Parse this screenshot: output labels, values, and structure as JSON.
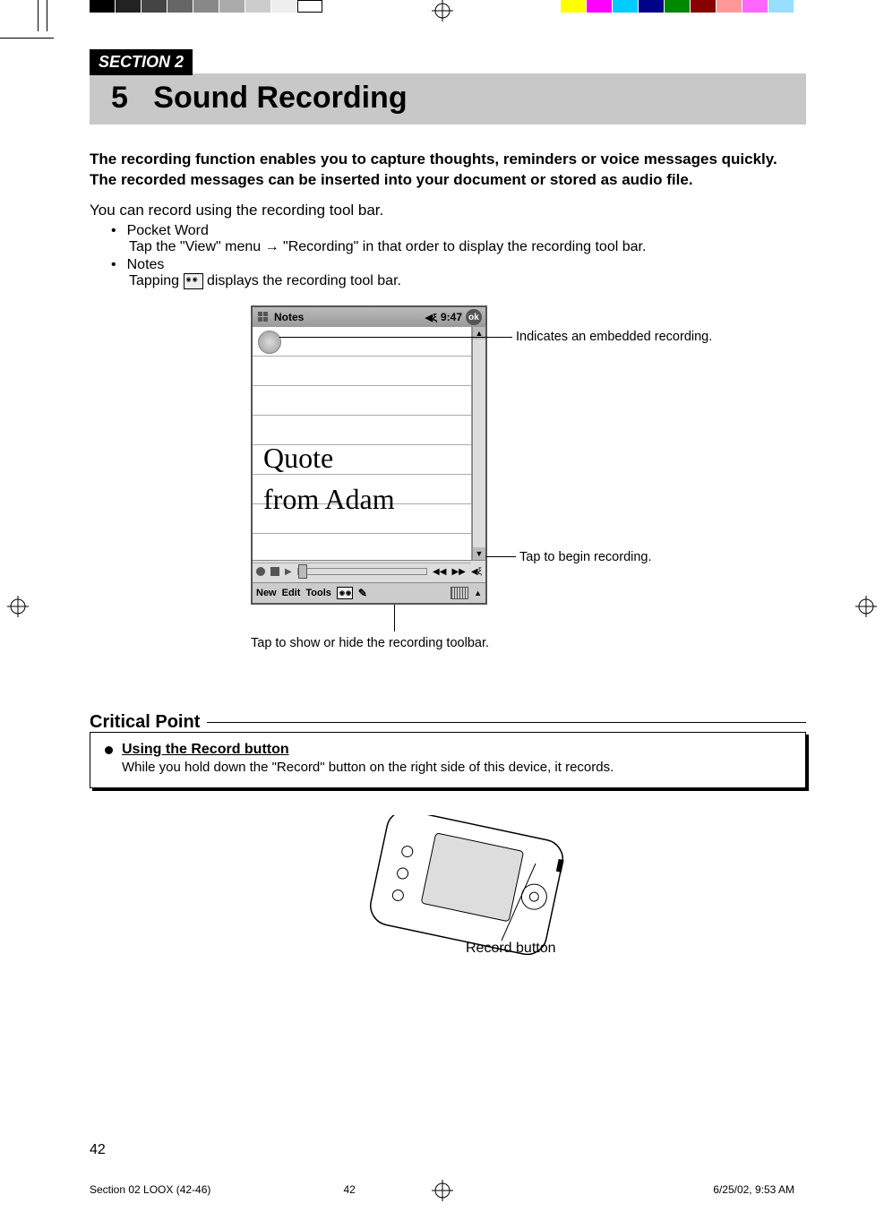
{
  "section_tab": "SECTION 2",
  "chapter_number": "5",
  "chapter_title": "Sound Recording",
  "intro": "The recording function enables you to capture thoughts, reminders or voice messages quickly. The recorded messages can be inserted into your document or stored as audio file.",
  "body_lead": "You can record using the recording tool bar.",
  "bullets": {
    "b1_head": "Pocket Word",
    "b1_sub": "Tap the \"View\" menu → \"Recording\" in that order to display the recording tool bar.",
    "b2_head": "Notes",
    "b2_sub_before": "Tapping ",
    "b2_sub_after": " displays the recording tool bar."
  },
  "screenshot": {
    "app_title": "Notes",
    "time": "9:47",
    "ok": "ok",
    "handwriting_line1": "Quote",
    "handwriting_line2": "from Adam",
    "menu_new": "New",
    "menu_edit": "Edit",
    "menu_tools": "Tools"
  },
  "callouts": {
    "embedded": "Indicates an embedded recording.",
    "begin": "Tap to begin recording.",
    "toolbar": "Tap to show or hide the recording toolbar."
  },
  "critical": {
    "heading": "Critical Point",
    "item_title": "Using the Record button",
    "item_body": "While you hold down the \"Record\" button on the right side of this device, it records."
  },
  "device_label": "Record button",
  "page_number": "42",
  "footer": {
    "left": "Section 02 LOOX (42-46)",
    "center": "42",
    "right": "6/25/02, 9:53 AM"
  }
}
